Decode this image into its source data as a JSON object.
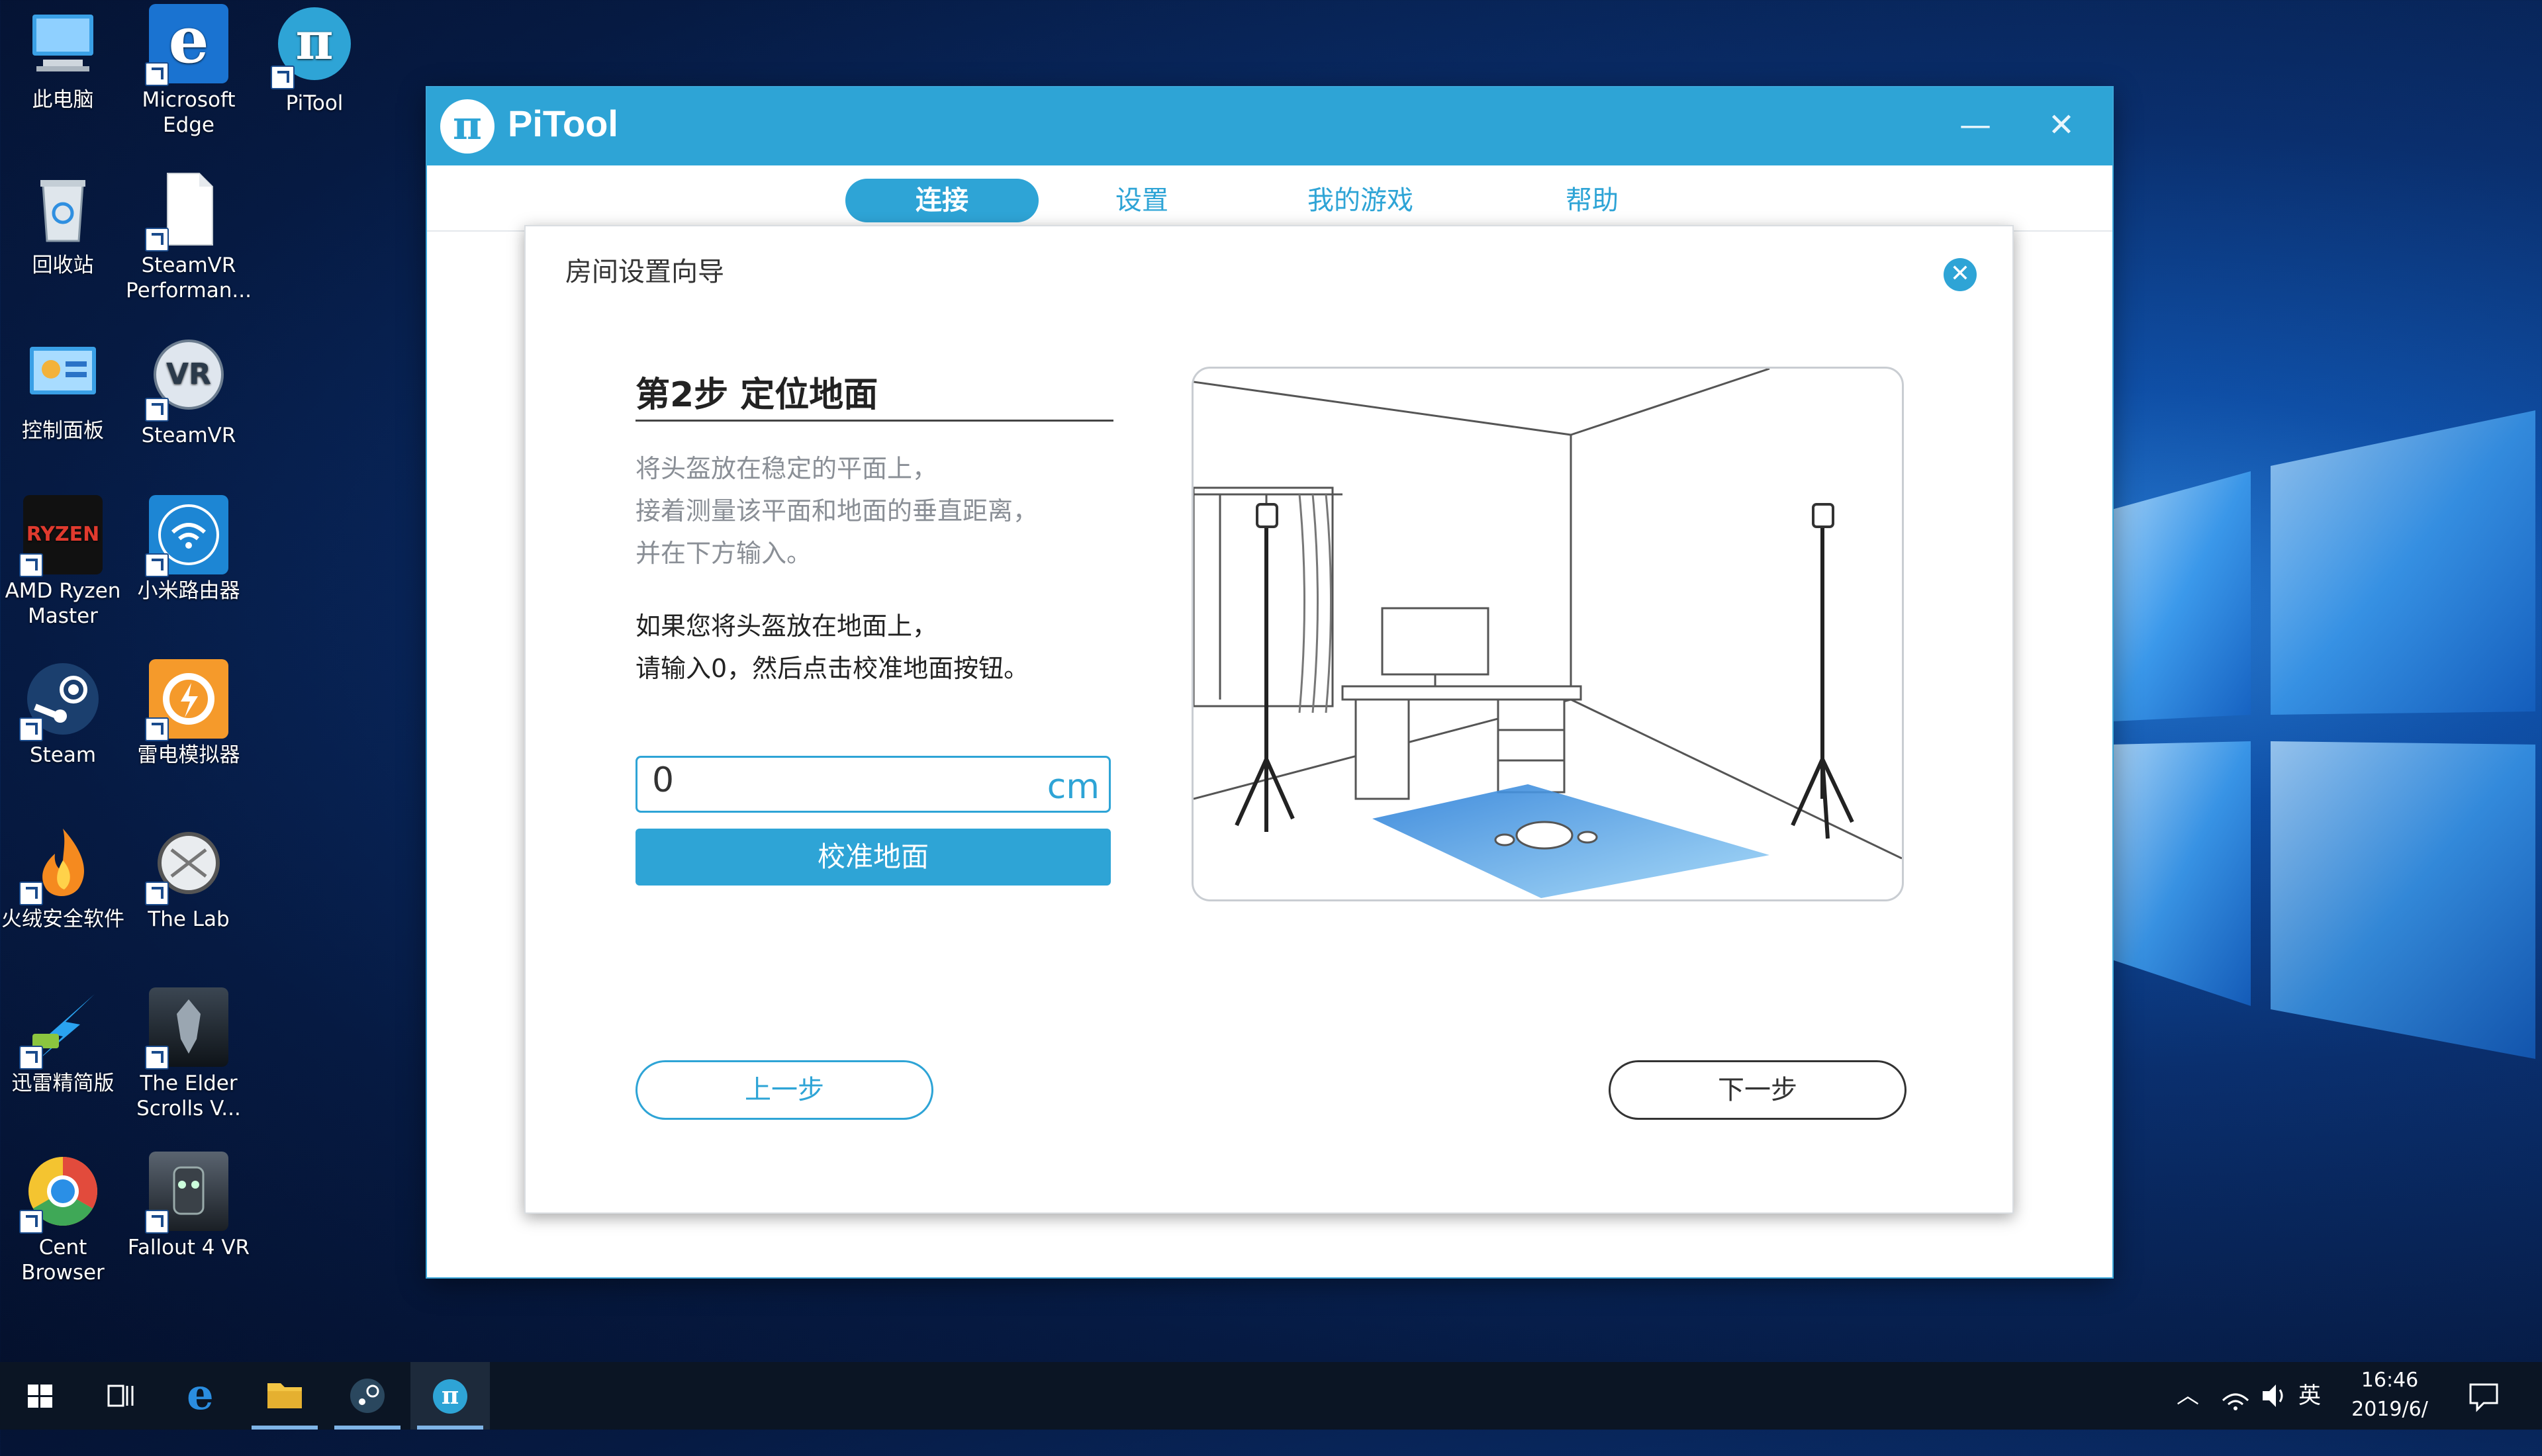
{
  "desktop": {
    "icons": [
      {
        "label": "此电脑"
      },
      {
        "label": "Microsoft Edge"
      },
      {
        "label": "PiTool"
      },
      {
        "label": "回收站"
      },
      {
        "label": "SteamVR Performan..."
      },
      {
        "label": "控制面板"
      },
      {
        "label": "SteamVR"
      },
      {
        "label": "AMD Ryzen Master"
      },
      {
        "label": "小米路由器"
      },
      {
        "label": "Steam"
      },
      {
        "label": "雷电模拟器"
      },
      {
        "label": "火绒安全软件"
      },
      {
        "label": "The Lab"
      },
      {
        "label": "迅雷精简版"
      },
      {
        "label": "The Elder Scrolls V..."
      },
      {
        "label": "Cent Browser"
      },
      {
        "label": "Fallout 4 VR"
      }
    ]
  },
  "window": {
    "title": "PiTool",
    "logo_glyph": "π",
    "minimize_glyph": "—",
    "close_glyph": "✕",
    "tabs": [
      {
        "label": "连接",
        "active": true
      },
      {
        "label": "设置",
        "active": false
      },
      {
        "label": "我的游戏",
        "active": false
      },
      {
        "label": "帮助",
        "active": false
      }
    ]
  },
  "dialog": {
    "title": "房间设置向导",
    "close_glyph": "✕",
    "step_title": "第2步 定位地面",
    "desc_lines": [
      "将头盔放在稳定的平面上，",
      "接着测量该平面和地面的垂直距离，",
      "并在下方输入。"
    ],
    "instr_lines": [
      "如果您将头盔放在地面上，",
      "请输入0，然后点击校准地面按钮。"
    ],
    "input_value": "0",
    "input_unit": "cm",
    "calibrate_label": "校准地面",
    "prev_label": "上一步",
    "next_label": "下一步"
  },
  "taskbar": {
    "tray_lang": "英",
    "time": "16:46",
    "date": "2019/6/"
  },
  "colors": {
    "accent": "#2ea4d6",
    "taskbar": "#0b1524"
  }
}
